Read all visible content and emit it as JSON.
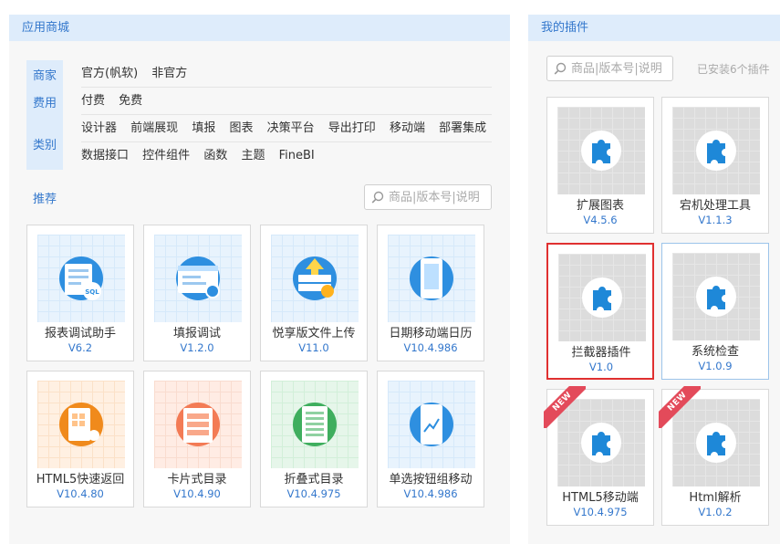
{
  "store": {
    "title": "应用商城",
    "filters": {
      "vendor_label": "商家",
      "vendor_options": [
        "官方(帆软)",
        "非官方"
      ],
      "price_label": "费用",
      "price_options": [
        "付费",
        "免费"
      ],
      "category_label": "类别",
      "category_options_row1": [
        "设计器",
        "前端展现",
        "填报",
        "图表",
        "决策平台",
        "导出打印",
        "移动端",
        "部署集成"
      ],
      "category_options_row2": [
        "数据接口",
        "控件组件",
        "函数",
        "主题",
        "FineBI"
      ]
    },
    "recommend_title": "推荐",
    "search_placeholder": "商品|版本号|说明",
    "cards": [
      {
        "name": "报表调试助手",
        "version": "V6.2",
        "icon": "sql-report-icon",
        "theme": "blue"
      },
      {
        "name": "填报调试",
        "version": "V1.2.0",
        "icon": "form-debug-icon",
        "theme": "blue"
      },
      {
        "name": "悦享版文件上传",
        "version": "V11.0",
        "icon": "file-upload-icon",
        "theme": "blue"
      },
      {
        "name": "日期移动端日历",
        "version": "V10.4.986",
        "icon": "mobile-calendar-icon",
        "theme": "blue"
      },
      {
        "name": "HTML5快速返回",
        "version": "V10.4.80",
        "icon": "html5-quick-return-icon",
        "theme": "orange"
      },
      {
        "name": "卡片式目录",
        "version": "V10.4.90",
        "icon": "card-catalog-icon",
        "theme": "salmon"
      },
      {
        "name": "折叠式目录",
        "version": "V10.4.975",
        "icon": "fold-catalog-icon",
        "theme": "green"
      },
      {
        "name": "单选按钮组移动",
        "version": "V10.4.986",
        "icon": "radio-group-mobile-icon",
        "theme": "blue"
      }
    ]
  },
  "my_plugins": {
    "title": "我的插件",
    "search_placeholder": "商品|版本号|说明",
    "installed_text": "已安装6个插件",
    "new_badge": "NEW",
    "plugins": [
      {
        "name": "扩展图表",
        "version": "V4.5.6",
        "icon": "puzzle-icon",
        "new": false
      },
      {
        "name": "宕机处理工具",
        "version": "V1.1.3",
        "icon": "puzzle-icon",
        "new": false
      },
      {
        "name": "拦截器插件",
        "version": "V1.0",
        "icon": "puzzle-icon",
        "new": false
      },
      {
        "name": "系统检查",
        "version": "V1.0.9",
        "icon": "puzzle-icon",
        "new": false
      },
      {
        "name": "HTML5移动端",
        "version": "V10.4.975",
        "icon": "puzzle-icon",
        "new": true
      },
      {
        "name": "Html解析",
        "version": "V1.0.2",
        "icon": "puzzle-icon",
        "new": true
      }
    ]
  },
  "colors": {
    "accent": "#3377cc",
    "header_bg": "#deecfb",
    "selected_border": "#e03030",
    "puzzle": "#1e88d8",
    "new_ribbon": "#e34a5a"
  }
}
